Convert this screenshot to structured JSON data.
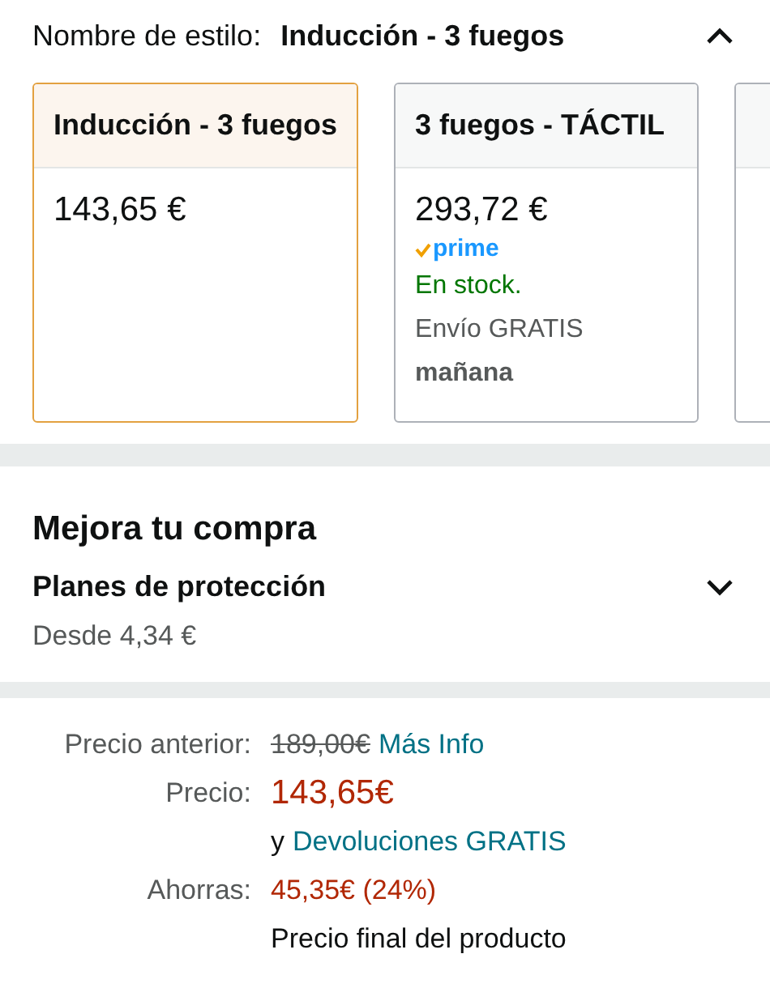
{
  "style_selector": {
    "label": "Nombre de estilo:",
    "value": "Inducción - 3 fuegos",
    "expanded": true
  },
  "style_options": [
    {
      "title": "Inducción - 3 fuegos",
      "price": "143,65 €",
      "selected": true
    },
    {
      "title": "3 fuegos - TÁCTIL",
      "price": "293,72 €",
      "prime": "prime",
      "stock": "En stock.",
      "shipping": "Envío GRATIS",
      "delivery": "mañana",
      "selected": false
    },
    {
      "selected": false
    }
  ],
  "upgrade": {
    "heading": "Mejora tu compra",
    "plan_title": "Planes de protección",
    "plan_price": "Desde 4,34 €",
    "expanded": false
  },
  "price_rows": [
    {
      "label": "Precio anterior:",
      "parts": [
        {
          "kind": "old",
          "text": "189,00€"
        },
        {
          "kind": "link",
          "text": "Más Info"
        }
      ]
    },
    {
      "label": "Precio:",
      "parts": [
        {
          "kind": "price",
          "text": "143,65€"
        }
      ]
    },
    {
      "parts": [
        {
          "kind": "plain",
          "text": "y"
        },
        {
          "kind": "link",
          "text": "Devoluciones GRATIS"
        }
      ]
    },
    {
      "label": "Ahorras:",
      "parts": [
        {
          "kind": "saving",
          "text": "45,35€ (24%)"
        }
      ]
    },
    {
      "parts": [
        {
          "kind": "plain",
          "text": "Precio final del producto"
        }
      ]
    }
  ]
}
